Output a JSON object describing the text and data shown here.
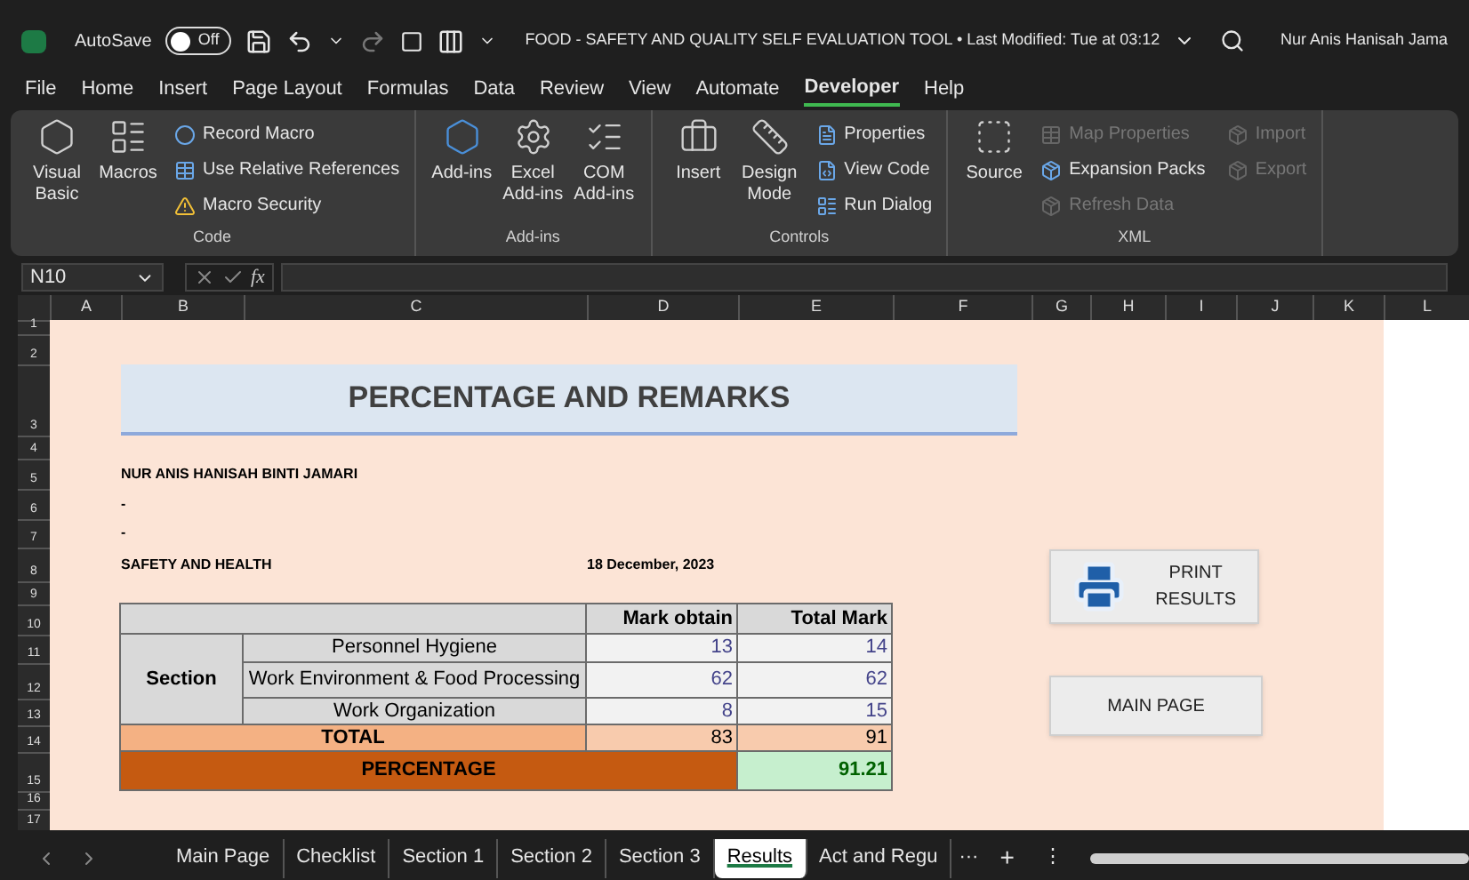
{
  "window": {
    "title": "FOOD - SAFETY AND QUALITY SELF EVALUATION TOOL • Last Modified: Tue at 03:12",
    "user": "Nur Anis Hanisah Jama",
    "autosave": {
      "label": "AutoSave",
      "on": false,
      "state_text": "Off"
    }
  },
  "menu": [
    {
      "label": "File",
      "selected": false
    },
    {
      "label": "Home",
      "selected": false
    },
    {
      "label": "Insert",
      "selected": false
    },
    {
      "label": "Page Layout",
      "selected": false
    },
    {
      "label": "Formulas",
      "selected": false
    },
    {
      "label": "Data",
      "selected": false
    },
    {
      "label": "Review",
      "selected": false
    },
    {
      "label": "View",
      "selected": false
    },
    {
      "label": "Automate",
      "selected": false
    },
    {
      "label": "Developer",
      "selected": true
    },
    {
      "label": "Help",
      "selected": false
    }
  ],
  "ribbon": [
    {
      "label": "Code",
      "large": [
        {
          "label": "Visual Basic"
        },
        {
          "label": "Macros"
        }
      ],
      "small": [
        {
          "label": "Record Macro",
          "disabled": false
        },
        {
          "label": "Use Relative References",
          "disabled": false
        },
        {
          "label": "Macro Security",
          "disabled": false
        }
      ]
    },
    {
      "label": "Add-ins",
      "large": [
        {
          "label": "Add-ins"
        },
        {
          "label": "Excel Add-ins"
        },
        {
          "label": "COM Add-ins"
        }
      ]
    },
    {
      "label": "Controls",
      "large": [
        {
          "label": "Insert"
        },
        {
          "label": "Design Mode"
        }
      ],
      "small": [
        {
          "label": "Properties",
          "disabled": false
        },
        {
          "label": "View Code",
          "disabled": false
        },
        {
          "label": "Run Dialog",
          "disabled": false
        }
      ]
    },
    {
      "label": "XML",
      "large": [
        {
          "label": "Source"
        }
      ],
      "small": [
        {
          "label": "Map Properties",
          "disabled": true
        },
        {
          "label": "Expansion Packs",
          "disabled": false
        },
        {
          "label": "Refresh Data",
          "disabled": true
        },
        {
          "label": "Import",
          "disabled": true
        },
        {
          "label": "Export",
          "disabled": true
        }
      ]
    }
  ],
  "name_box": "N10",
  "function_symbol": "fx",
  "columns": [
    "A",
    "B",
    "C",
    "D",
    "E",
    "F",
    "G",
    "H",
    "I",
    "J",
    "K",
    "L"
  ],
  "rows": [
    "1",
    "2",
    "3",
    "4",
    "5",
    "6",
    "7",
    "8",
    "9",
    "10",
    "11",
    "12",
    "13",
    "14",
    "15",
    "16",
    "17"
  ],
  "sheet": {
    "title": "PERCENTAGE AND REMARKS",
    "name": "NUR ANIS HANISAH BINTI JAMARI",
    "line_2": "-",
    "line_3": "-",
    "department": "SAFETY AND HEALTH",
    "date": "18 December, 2023"
  },
  "table": {
    "headers": [
      "Mark obtain",
      "Total Mark"
    ],
    "group_label": "Section",
    "rows": [
      {
        "label": "Personnel Hygiene",
        "obtained": "13",
        "total": "14"
      },
      {
        "label": "Work Environment & Food Processing",
        "obtained": "62",
        "total": "62"
      },
      {
        "label": "Work Organization",
        "obtained": "8",
        "total": "15"
      }
    ],
    "total": {
      "label": "TOTAL",
      "obtained": "83",
      "total": "91"
    },
    "percentage": {
      "label": "PERCENTAGE",
      "value": "91.21"
    }
  },
  "buttons": [
    {
      "label": "PRINT",
      "label_2": "RESULTS",
      "kind": "print"
    },
    {
      "label": "MAIN PAGE",
      "kind": "plain"
    }
  ],
  "sheet_tabs": [
    {
      "label": "Main Page",
      "selected": false
    },
    {
      "label": "Checklist",
      "selected": false
    },
    {
      "label": "Section 1",
      "selected": false
    },
    {
      "label": "Section 2",
      "selected": false
    },
    {
      "label": "Section 3",
      "selected": false
    },
    {
      "label": "Results",
      "selected": true
    },
    {
      "label": "Act and Regu",
      "selected": false
    }
  ],
  "tab_controls": {
    "more": "···",
    "add": "+",
    "options": "⋮"
  }
}
